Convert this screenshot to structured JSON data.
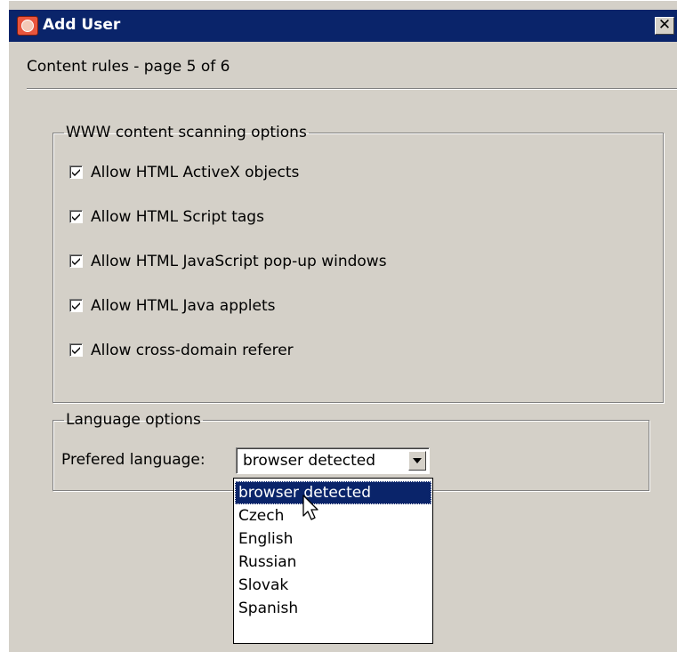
{
  "window": {
    "title": "Add User",
    "close_label": "✕"
  },
  "page": {
    "subtitle": "Content rules - page 5 of 6"
  },
  "www_group": {
    "legend": "WWW content scanning options",
    "options": [
      {
        "label": "Allow HTML ActiveX objects",
        "checked": true
      },
      {
        "label": "Allow HTML Script tags",
        "checked": true
      },
      {
        "label": "Allow HTML JavaScript pop-up windows",
        "checked": true
      },
      {
        "label": "Allow HTML Java applets",
        "checked": true
      },
      {
        "label": "Allow cross-domain referer",
        "checked": true
      }
    ]
  },
  "language_group": {
    "legend": "Language options",
    "label": "Prefered language:",
    "selected": "browser detected",
    "options": [
      "browser detected",
      "Czech",
      "English",
      "Russian",
      "Slovak",
      "Spanish"
    ]
  },
  "colors": {
    "titlebar": "#0a246a",
    "dialog_bg": "#d4d0c8",
    "selection": "#0a246a"
  }
}
